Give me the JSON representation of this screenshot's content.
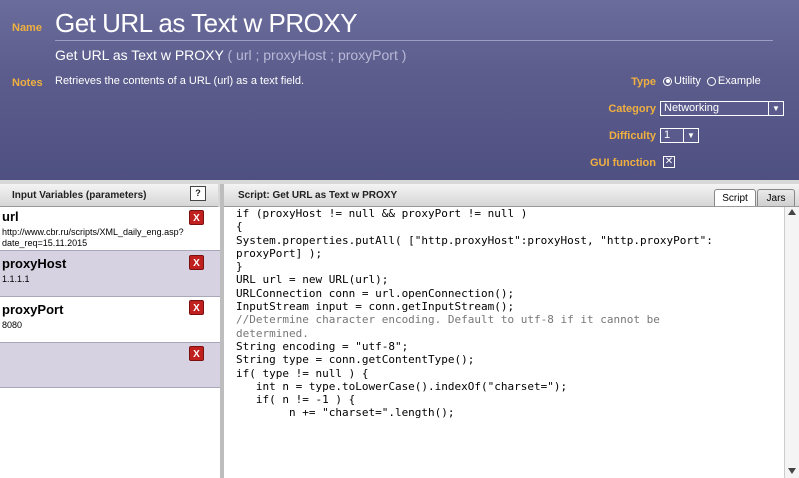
{
  "header": {
    "name_label": "Name",
    "title": "Get URL as Text w PROXY",
    "signature_name": "Get URL as Text w PROXY",
    "signature_args": " ( url ; proxyHost ; proxyPort )",
    "notes_label": "Notes",
    "notes": "Retrieves the contents of a URL (url) as a text field.",
    "type_label": "Type",
    "type_options": [
      "Utility",
      "Example"
    ],
    "type_selected": "Utility",
    "category_label": "Category",
    "category_value": "Networking",
    "difficulty_label": "Difficulty",
    "difficulty_value": "1",
    "gui_label": "GUI function",
    "gui_checked": "✕"
  },
  "left_panel": {
    "title": "Input Variables (parameters)",
    "help": "?",
    "delete_label": "X",
    "variables": [
      {
        "name": "url",
        "value": "http://www.cbr.ru/scripts/XML_daily_eng.asp?date_req=15.11.2015"
      },
      {
        "name": "proxyHost",
        "value": "1.1.1.1"
      },
      {
        "name": "proxyPort",
        "value": "8080"
      },
      {
        "name": "",
        "value": ""
      }
    ]
  },
  "right_panel": {
    "title": "Script: Get URL as Text w PROXY",
    "tabs": [
      "Script",
      "Jars"
    ],
    "active_tab": "Script"
  },
  "code_lines": [
    "if (proxyHost != null && proxyPort != null )",
    "{",
    "System.properties.putAll( [\"http.proxyHost\":proxyHost, \"http.proxyPort\":",
    "proxyPort] );",
    "}",
    "",
    "",
    "URL url = new URL(url);",
    "URLConnection conn = url.openConnection();",
    "InputStream input = conn.getInputStream();",
    "",
    "//Determine character encoding. Default to utf-8 if it cannot be",
    "determined.",
    "String encoding = \"utf-8\";",
    "String type = conn.getContentType();",
    "if( type != null ) {",
    "   int n = type.toLowerCase().indexOf(\"charset=\");",
    "   if( n != -1 ) {",
    "        n += \"charset=\".length();"
  ]
}
